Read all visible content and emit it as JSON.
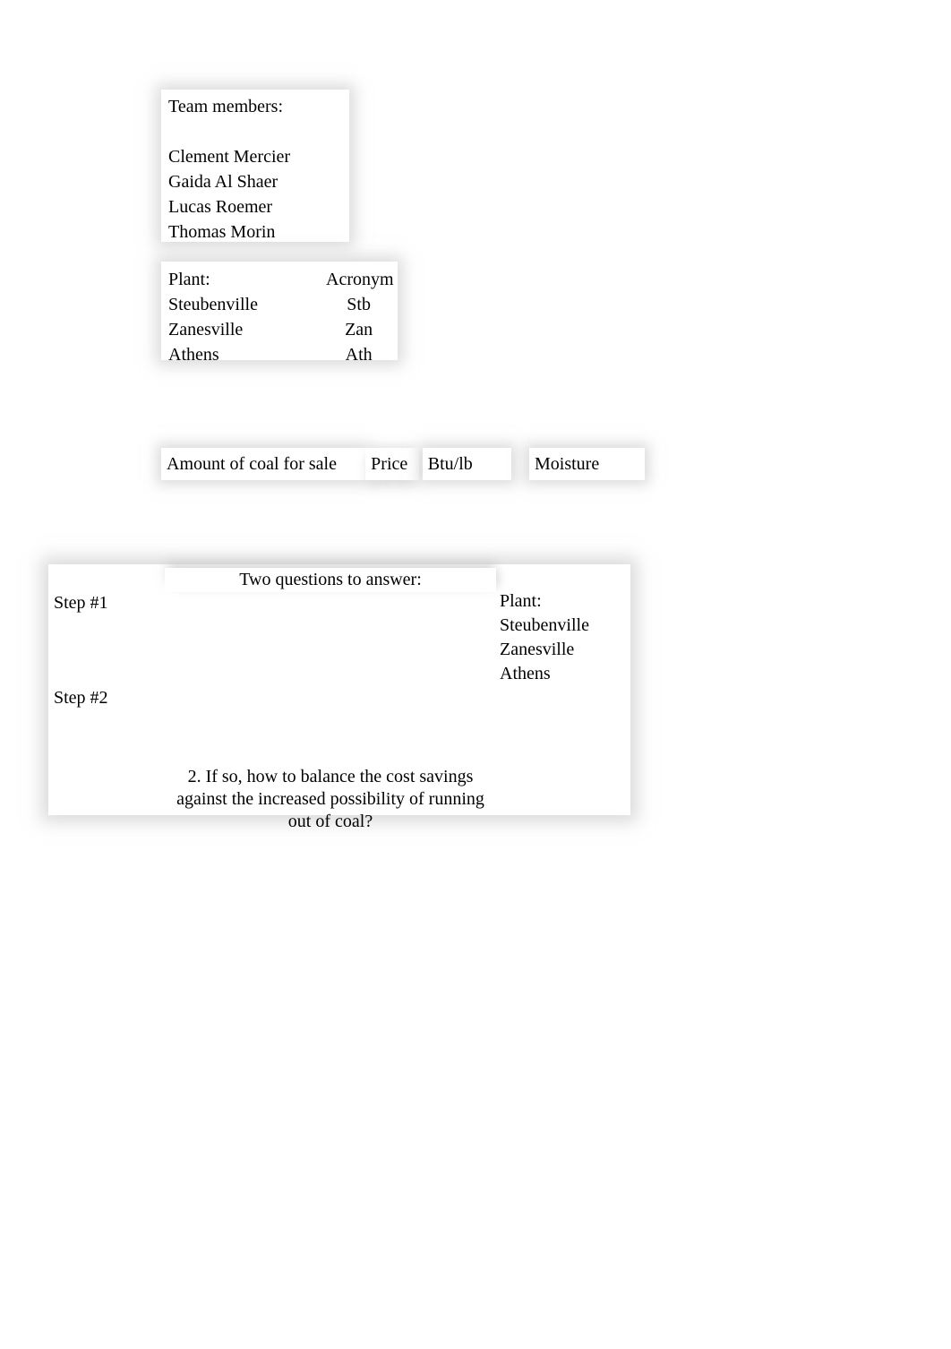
{
  "team": {
    "heading": "Team members:",
    "members": [
      "Clement Mercier",
      "Gaida Al Shaer",
      "Lucas Roemer",
      "Thomas Morin"
    ]
  },
  "plant_table": {
    "headers": {
      "plant": "Plant:",
      "acronym": "Acronym"
    },
    "rows": [
      {
        "plant": "Steubenville",
        "acronym": "Stb"
      },
      {
        "plant": "Zanesville",
        "acronym": "Zan"
      },
      {
        "plant": "Athens",
        "acronym": "Ath"
      }
    ]
  },
  "coal_headers": {
    "amount": "Amount of coal for sale",
    "price": "Price",
    "btu": "Btu/lb",
    "moisture": "Moisture"
  },
  "steps": {
    "questions_title": "Two questions to answer:",
    "step1": "Step #1",
    "step2": "Step #2",
    "plant_heading": "Plant:",
    "plants": [
      "Steubenville",
      "Zanesville",
      "Athens"
    ],
    "question2": "2. If so, how to balance the cost savings against the increased possibility of running out of coal?"
  }
}
